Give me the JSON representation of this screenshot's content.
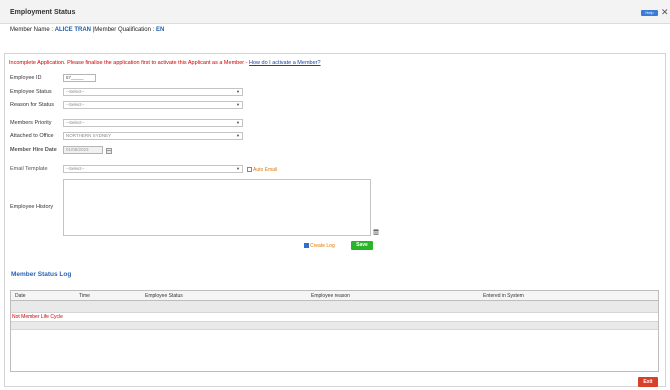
{
  "window": {
    "title": "Employment Status",
    "help_label": "Help",
    "close_glyph": "✕"
  },
  "member": {
    "name_label": "Member Name :",
    "name": "ALICE TRAN",
    "separator": "|",
    "qualification_label": "Member Qualification :",
    "qualification": "EN"
  },
  "notice": {
    "text": "Incomplete Application. Please finalise the application first to activate this Applicant as a Member - ",
    "link": "How do I activate a Member?"
  },
  "form": {
    "employee_id": {
      "label": "Employee ID",
      "value": "87_____"
    },
    "employee_status": {
      "label": "Employee Status",
      "value": "--Select--"
    },
    "reason_for_status": {
      "label": "Reason for Status",
      "value": "--Select--"
    },
    "members_priority": {
      "label": "Members Priority",
      "value": "--Select--"
    },
    "attached_to_office": {
      "label": "Attached to Office",
      "value": "NORTHERN SYDNEY"
    },
    "member_hire_date": {
      "label": "Member Hire Date",
      "value": "01/08/2023"
    },
    "email_template": {
      "label": "Email Template",
      "value": "--Select--"
    },
    "auto_email": {
      "label": "Auto Email",
      "checked": false
    },
    "employee_history": {
      "label": "Employee History",
      "value": ""
    },
    "create_log": {
      "label": "Create Log",
      "checked": true
    },
    "save_label": "Save"
  },
  "log": {
    "title": "Member Status Log",
    "columns": [
      "Date",
      "Time",
      "Employee Status",
      "Employee reason",
      "Entered in System"
    ],
    "empty_message": "Not Member Life Cycle"
  },
  "footer": {
    "exit_label": "Exit"
  },
  "colors": {
    "accent_blue": "#2a63b5",
    "warning_red": "#cc0000",
    "save_green": "#28b528",
    "exit_red": "#d9402b"
  }
}
